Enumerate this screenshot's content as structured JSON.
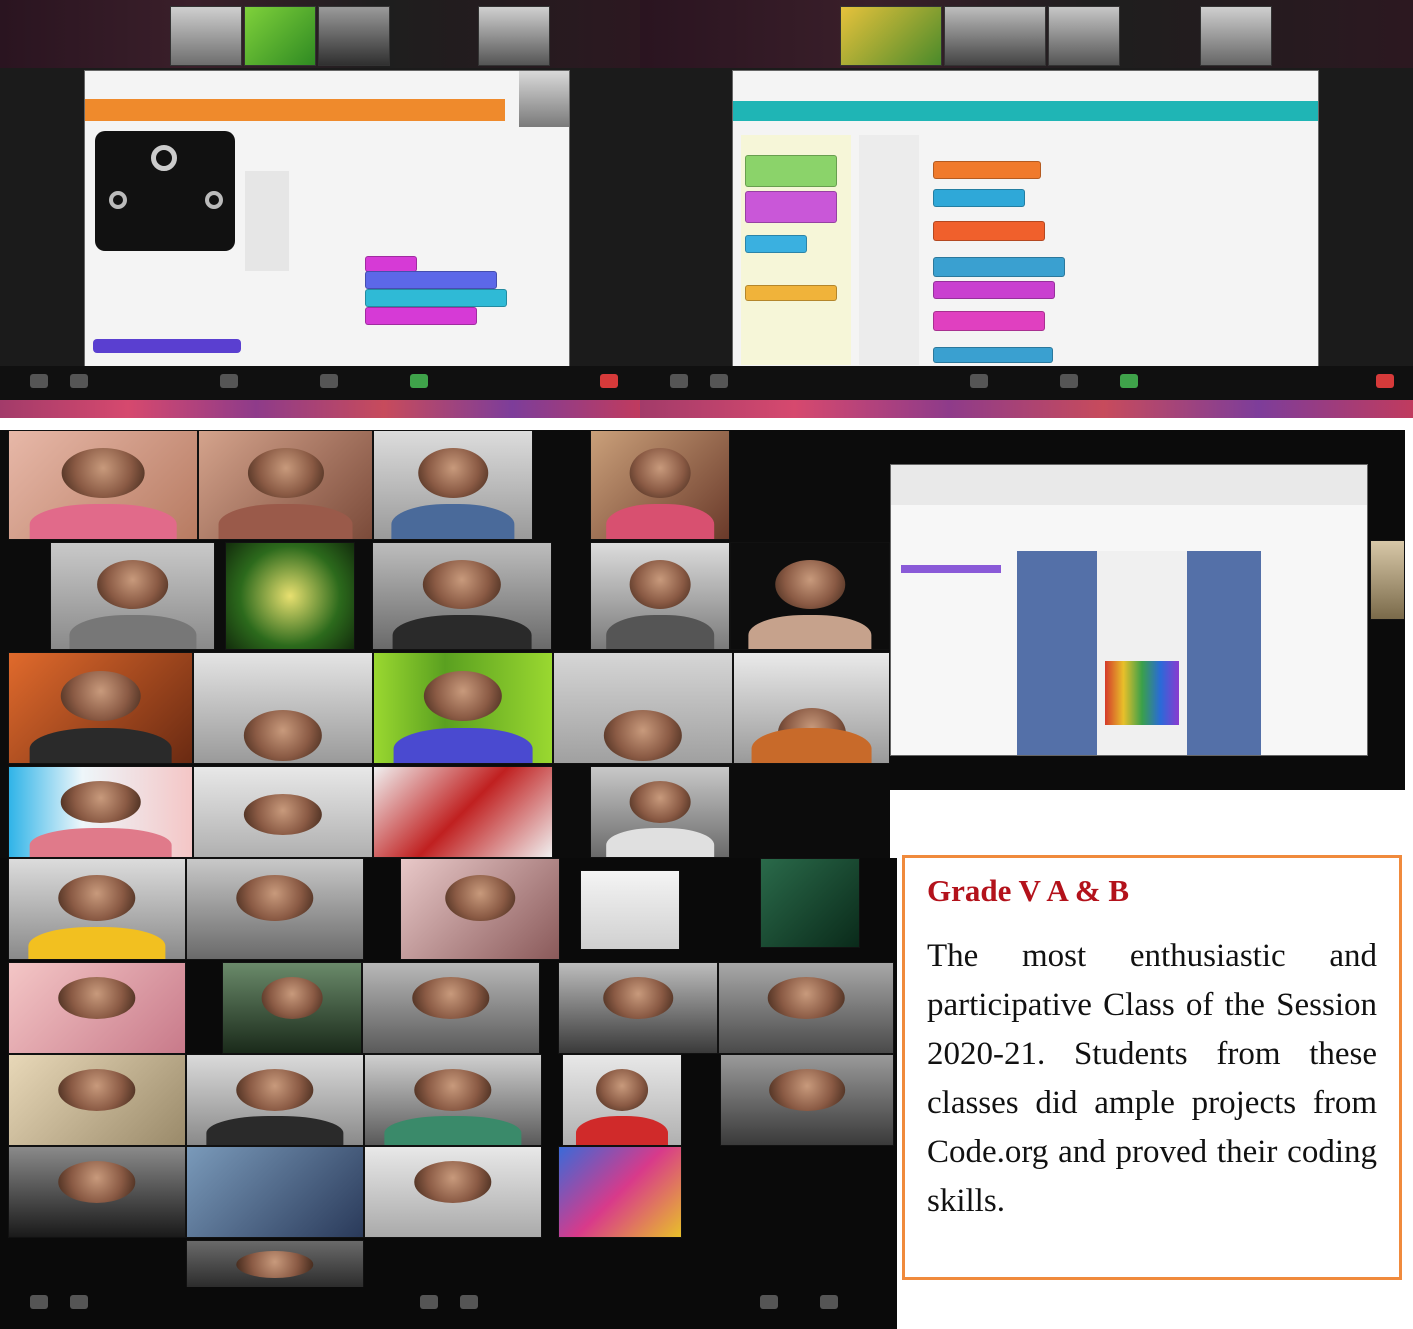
{
  "caption": {
    "title": "Grade V A & B",
    "text": "The most enthusiastic and participative Class of the Session 2020-21. Students from these classes did ample projects from Code.org and proved their coding skills."
  },
  "colors": {
    "caption_title": "#b3121b",
    "caption_border": "#f08a3c",
    "zoom_dark": "#1b1b1b",
    "makecode_orange": "#ef8a2c",
    "codeorg_teal": "#1fb5b5"
  },
  "screens": {
    "top_left": "MakeCode micro:bit editor shared in video call",
    "top_right": "Code.org block editor shared in video call",
    "middle_right": "Code.org project page shared in video call"
  },
  "icons": [
    "video-tile",
    "block-code",
    "microbit-board",
    "meeting-toolbar"
  ]
}
